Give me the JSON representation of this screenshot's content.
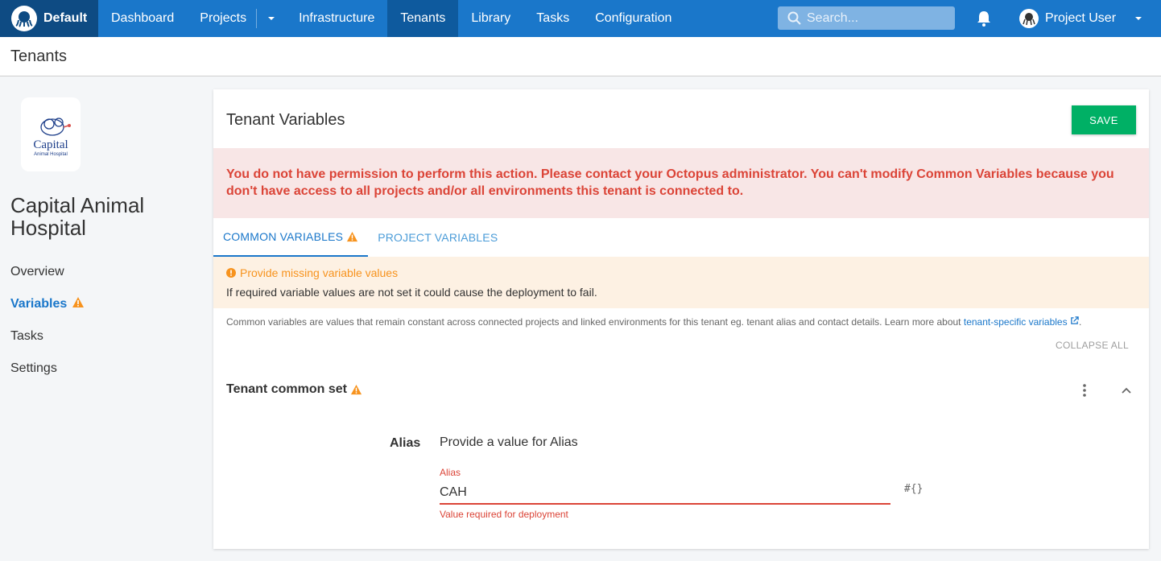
{
  "colors": {
    "nav_bg": "#1a77ca",
    "nav_dark": "#0e4b83",
    "save": "#00b065",
    "error": "#db4437",
    "warning": "#f7931e",
    "link": "#1a77ca"
  },
  "topnav": {
    "space": "Default",
    "items": [
      "Dashboard",
      "Projects",
      "Infrastructure",
      "Tenants",
      "Library",
      "Tasks",
      "Configuration"
    ],
    "active": "Tenants",
    "search_placeholder": "Search...",
    "user": "Project User"
  },
  "page": {
    "title": "Tenants"
  },
  "sidebar": {
    "logo_text": "Capital",
    "logo_subtext": "Animal Hospital",
    "tenant_name": "Capital Animal Hospital",
    "items": [
      {
        "label": "Overview"
      },
      {
        "label": "Variables"
      },
      {
        "label": "Tasks"
      },
      {
        "label": "Settings"
      }
    ]
  },
  "main": {
    "title": "Tenant Variables",
    "save_label": "SAVE",
    "error_message": "You do not have permission to perform this action. Please contact your Octopus administrator. You can't modify Common Variables because you don't have access to all projects and/or all environments this tenant is connected to.",
    "tabs": [
      {
        "label": "COMMON VARIABLES"
      },
      {
        "label": "PROJECT VARIABLES"
      }
    ],
    "warning": {
      "title": "Provide missing variable values",
      "message": "If required variable values are not set it could cause the deployment to fail."
    },
    "info": {
      "text": "Common variables are values that remain constant across connected projects and linked environments for this tenant eg. tenant alias and contact details. Learn more about ",
      "link": "tenant-specific variables",
      "suffix": "."
    },
    "collapse_all": "COLLAPSE ALL",
    "set": {
      "title": "Tenant common set",
      "variable": {
        "name": "Alias",
        "hint": "Provide a value for Alias",
        "field_label": "Alias",
        "value": "CAH",
        "error": "Value required for deployment",
        "binding_icon": "#{}"
      }
    }
  }
}
